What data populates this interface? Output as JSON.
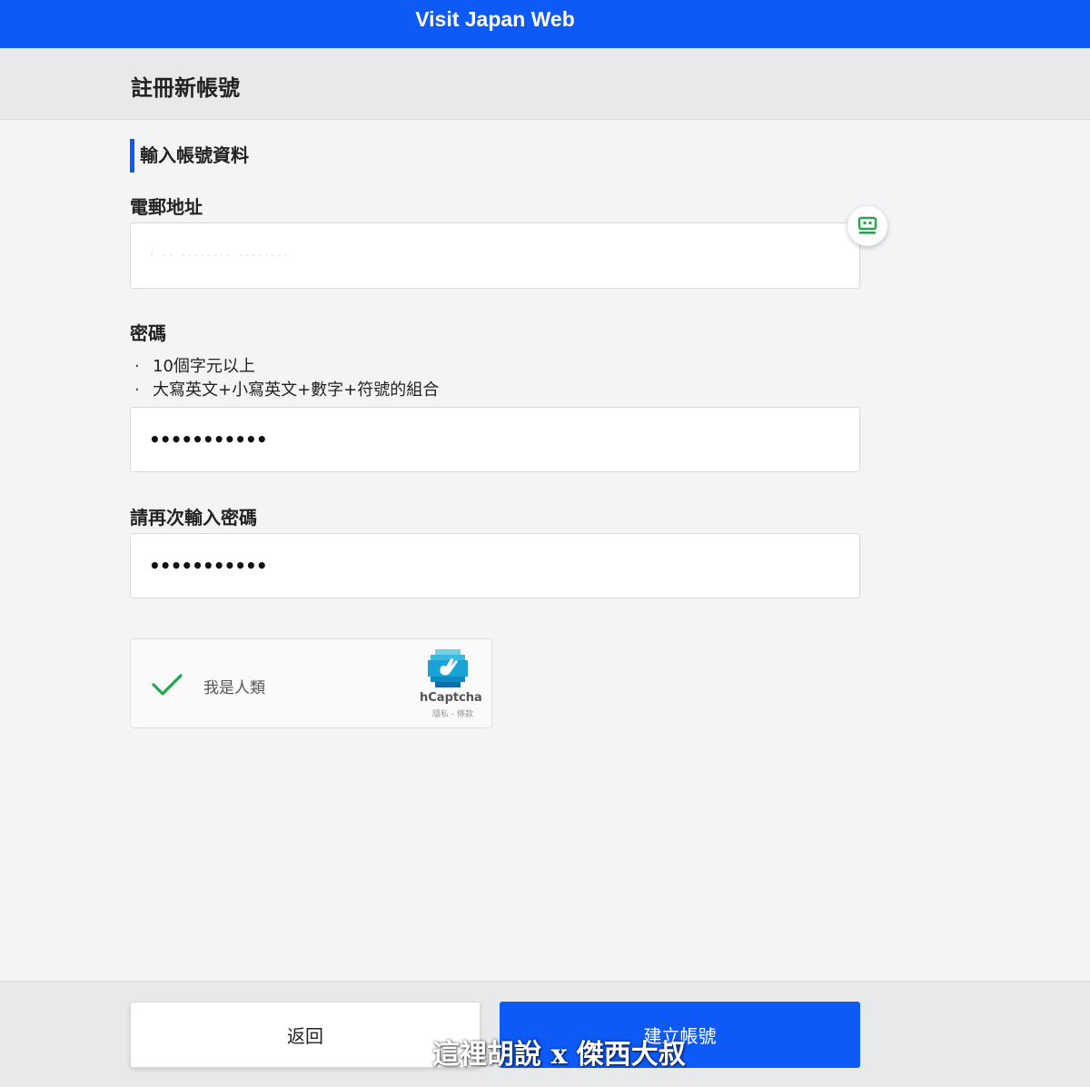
{
  "header": {
    "brand": "Visit Japan Web"
  },
  "page": {
    "title": "註冊新帳號",
    "section_heading": "輸入帳號資料"
  },
  "form": {
    "email": {
      "label": "電郵地址",
      "value": ": ..   ........ ........"
    },
    "password": {
      "label": "密碼",
      "rules": [
        "10個字元以上",
        "大寫英文+小寫英文+數字+符號的組合"
      ],
      "masked_value": "•••••••••••"
    },
    "confirm_password": {
      "label": "請再次輸入密碼",
      "masked_value": "•••••••••••"
    }
  },
  "captcha": {
    "label": "我是人類",
    "provider": "hCaptcha",
    "links": "隱私 - 條款",
    "checked": true
  },
  "footer": {
    "back_label": "返回",
    "create_label": "建立帳號"
  },
  "watermark": "這裡胡說 x 傑西大叔",
  "colors": {
    "accent": "#0d5af7",
    "check": "#22a84a"
  },
  "icons": {
    "extension": "password-manager-icon",
    "captcha_check": "check-icon",
    "captcha_logo": "hcaptcha-logo-icon"
  }
}
